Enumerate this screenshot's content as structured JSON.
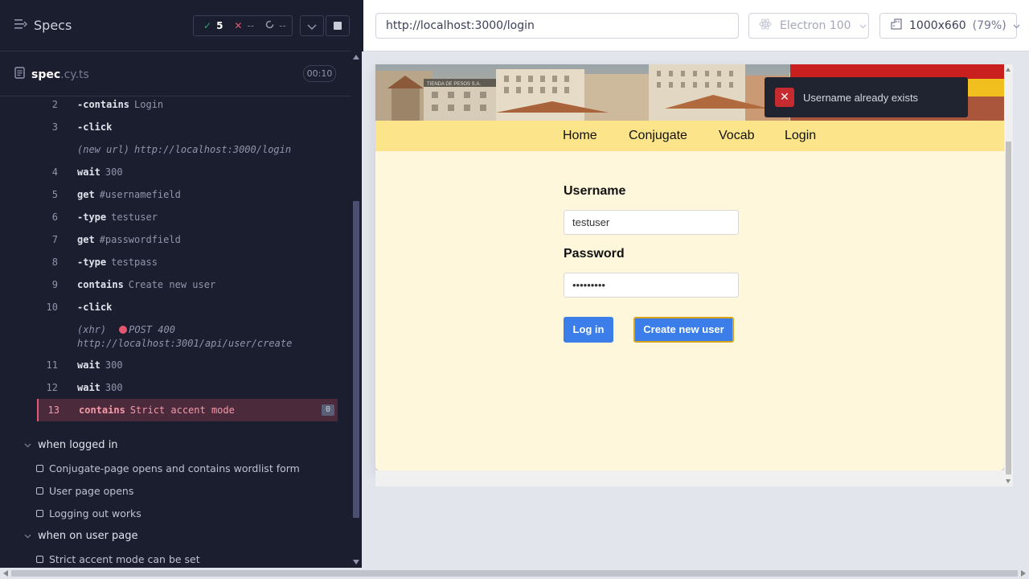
{
  "reporter": {
    "title": "Specs",
    "stats": {
      "passed": "5",
      "failed": "--",
      "pending": "--"
    },
    "file": {
      "base": "spec",
      "ext": ".cy.ts",
      "duration": "00:10"
    },
    "commands": [
      {
        "num": "2",
        "name": "-contains",
        "msg": "Login"
      },
      {
        "num": "3",
        "name": "-click",
        "msg": ""
      },
      {
        "num": "",
        "name": "(new url)",
        "msg": "http://localhost:3000/login"
      },
      {
        "num": "4",
        "name": "wait",
        "msg": "300"
      },
      {
        "num": "5",
        "name": "get",
        "msg": "#usernamefield"
      },
      {
        "num": "6",
        "name": "-type",
        "msg": "testuser"
      },
      {
        "num": "7",
        "name": "get",
        "msg": "#passwordfield"
      },
      {
        "num": "8",
        "name": "-type",
        "msg": "testpass"
      },
      {
        "num": "9",
        "name": "contains",
        "msg": "Create new user"
      },
      {
        "num": "10",
        "name": "-click",
        "msg": ""
      },
      {
        "num": "",
        "name": "(xhr)",
        "msg": "POST 400",
        "url": "http://localhost:3001/api/user/create"
      },
      {
        "num": "11",
        "name": "wait",
        "msg": "300"
      },
      {
        "num": "12",
        "name": "wait",
        "msg": "300"
      },
      {
        "num": "13",
        "name": "contains",
        "msg": "Strict accent mode",
        "badge": "0"
      }
    ],
    "suites": [
      {
        "title": "when logged in",
        "tests": [
          "Conjugate-page opens and contains wordlist form",
          "User page opens",
          "Logging out works"
        ]
      },
      {
        "title": "when on user page",
        "tests": [
          "Strict accent mode can be set"
        ]
      }
    ]
  },
  "browser": {
    "url": "http://localhost:3000/login",
    "browser_name": "Electron 100",
    "viewport": "1000x660",
    "zoom": "(79%)"
  },
  "app": {
    "nav": [
      "Home",
      "Conjugate",
      "Vocab",
      "Login"
    ],
    "username_label": "Username",
    "username_value": "testuser",
    "password_label": "Password",
    "password_value": "•••••••••",
    "login_button": "Log in",
    "create_button": "Create new user",
    "toast_message": "Username already exists",
    "sign_text": "TIENDA DE PESOS S.A."
  },
  "colors": {
    "reporter_bg": "#1b1e2e",
    "fail": "#e45770",
    "pass": "#1fa971",
    "navbar": "#fce48b",
    "app_bg": "#fef7dc",
    "button": "#3b7de9",
    "toast_x": "#c62b30"
  }
}
